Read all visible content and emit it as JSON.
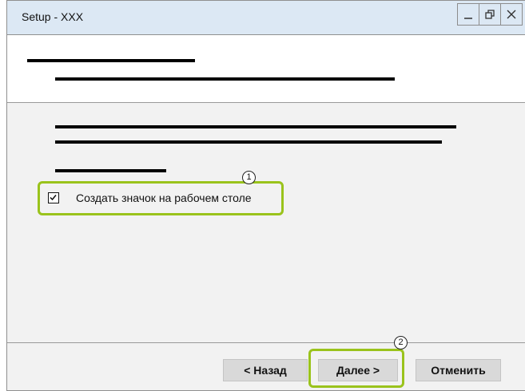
{
  "window": {
    "title": "Setup - XXX",
    "controls": [
      {
        "name": "minimize",
        "glyph": "—"
      },
      {
        "name": "restore",
        "glyph": "❐"
      },
      {
        "name": "close",
        "glyph": "✕"
      }
    ]
  },
  "options": {
    "desktop_icon": {
      "label": "Создать значок на рабочем столе",
      "checked": true
    }
  },
  "callouts": {
    "one": "1",
    "two": "2"
  },
  "buttons": {
    "back": "< Назад",
    "next": "Далее >",
    "cancel": "Отменить"
  },
  "colors": {
    "titlebar": "#dce8f4",
    "highlight": "#9ac31c",
    "panel": "#f2f2f2",
    "button": "#d9d9d9"
  }
}
